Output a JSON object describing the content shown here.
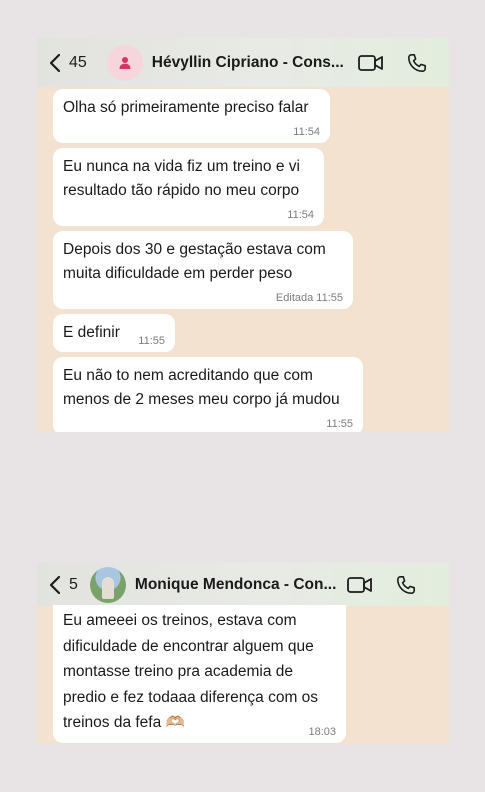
{
  "chat1": {
    "back_count": "45",
    "contact_name": "Hévyllin Cipriano - Cons...",
    "messages": [
      {
        "text": "Olha só primeiramente preciso falar",
        "time": "11:54"
      },
      {
        "text": "Eu nunca na vida fiz um treino e vi resultado tão rápido no meu corpo",
        "time": "11:54"
      },
      {
        "text": "Depois dos 30 e gestação estava com muita dificuldade em perder peso",
        "time": "Editada 11:55"
      },
      {
        "text": "E definir",
        "time": "11:55"
      },
      {
        "text": "Eu não to nem acreditando que com menos de 2 meses meu corpo já mudou",
        "time": "11:55"
      }
    ]
  },
  "chat2": {
    "back_count": "5",
    "contact_name": "Monique Mendonca - Con...",
    "messages": [
      {
        "text": "Eu ameeei os treinos, estava com dificuldade de encontrar alguem que montasse treino pra academia de predio e fez todaaa diferença com os treinos da fefa 🫶🏼",
        "time": "18:03"
      }
    ]
  },
  "colors": {
    "page_bg": "#e8e3e4",
    "chat_bg": "#f3e2cf",
    "bubble_bg": "#ffffff",
    "avatar_placeholder": "#f6d6dc",
    "avatar_icon": "#d5336a"
  },
  "icons": [
    "chevron-left-icon",
    "person-icon",
    "video-camera-icon",
    "phone-icon"
  ]
}
